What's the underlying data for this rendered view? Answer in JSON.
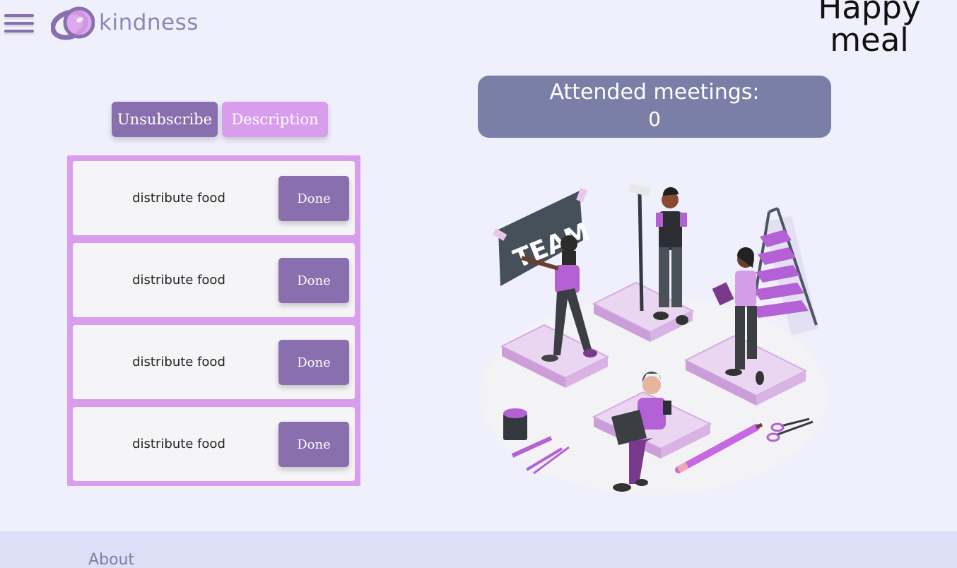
{
  "header": {
    "brand": "kindness",
    "title_line1": "Happy",
    "title_line2": "meal"
  },
  "actions": {
    "unsubscribe_label": "Unsubscribe",
    "description_label": "Description"
  },
  "tasks": [
    {
      "text": "distribute food",
      "button": "Done"
    },
    {
      "text": "distribute food",
      "button": "Done"
    },
    {
      "text": "distribute food",
      "button": "Done"
    },
    {
      "text": "distribute food",
      "button": "Done"
    }
  ],
  "meetings": {
    "label": "Attended meetings:",
    "count": "0"
  },
  "illustration": {
    "sign_text": "TEAM"
  },
  "footer": {
    "about_label": "About"
  },
  "colors": {
    "primary_purple": "#8a6fae",
    "light_purple": "#d99ded",
    "meetings_card": "#7a7fa8",
    "background": "#eff0fb",
    "footer": "#dddff7"
  }
}
